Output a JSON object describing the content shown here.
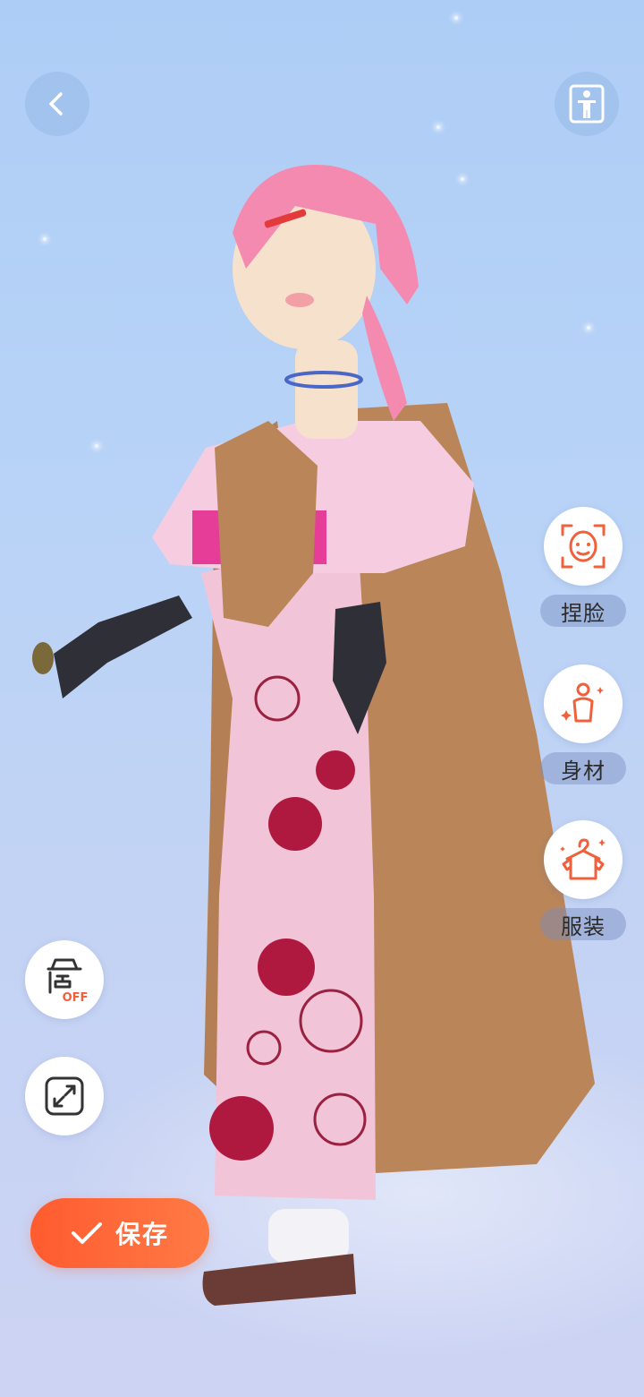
{
  "colors": {
    "accent": "#ff5b2f",
    "tool_icon": "#f0603a",
    "background_top": "#aecdf6",
    "background_bottom": "#cdd3f3"
  },
  "top_bar": {
    "back_icon": "chevron-left-icon",
    "right_icon": "body-outline-icon"
  },
  "side_tools": [
    {
      "id": "face",
      "label": "捏脸",
      "icon": "face-scan-icon"
    },
    {
      "id": "body",
      "label": "身材",
      "icon": "body-sparkle-icon"
    },
    {
      "id": "outfit",
      "label": "服装",
      "icon": "hanger-shirt-icon"
    }
  ],
  "left_tools": {
    "light": {
      "icon": "lamp-icon",
      "badge": "OFF"
    },
    "expand": {
      "icon": "expand-arrows-icon"
    }
  },
  "save_button": {
    "label": "保存",
    "icon": "check-icon"
  }
}
